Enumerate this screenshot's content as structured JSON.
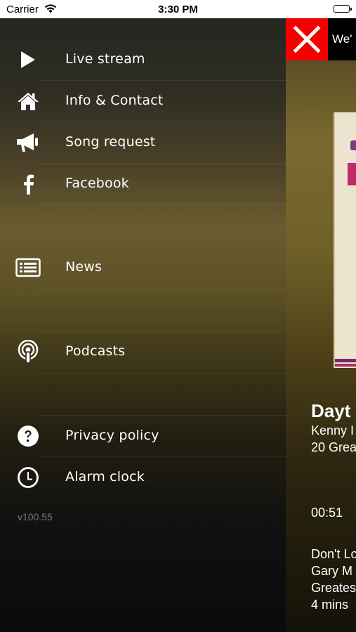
{
  "status_bar": {
    "carrier": "Carrier",
    "time": "3:30 PM"
  },
  "menu": {
    "items": [
      {
        "label": "Live stream",
        "icon": "play-icon"
      },
      {
        "label": "Info & Contact",
        "icon": "home-icon"
      },
      {
        "label": "Song request",
        "icon": "megaphone-icon"
      },
      {
        "label": "Facebook",
        "icon": "facebook-icon"
      },
      {
        "label": "News",
        "icon": "news-icon"
      },
      {
        "label": "Podcasts",
        "icon": "podcast-icon"
      },
      {
        "label": "Privacy policy",
        "icon": "question-icon"
      },
      {
        "label": "Alarm clock",
        "icon": "clock-icon"
      }
    ],
    "version": "v100.55"
  },
  "player": {
    "banner_text": "We'",
    "now_playing": {
      "title": "Dayt",
      "artist": "Kenny I",
      "album": "20 Grea",
      "elapsed": "00:51"
    },
    "up_next": {
      "title": "Don't Lo",
      "artist": "Gary M",
      "album": "Greates",
      "length": "4 mins"
    }
  },
  "colors": {
    "close_button": "#f40000",
    "text": "#ffffff",
    "version_text": "#7a7668"
  }
}
